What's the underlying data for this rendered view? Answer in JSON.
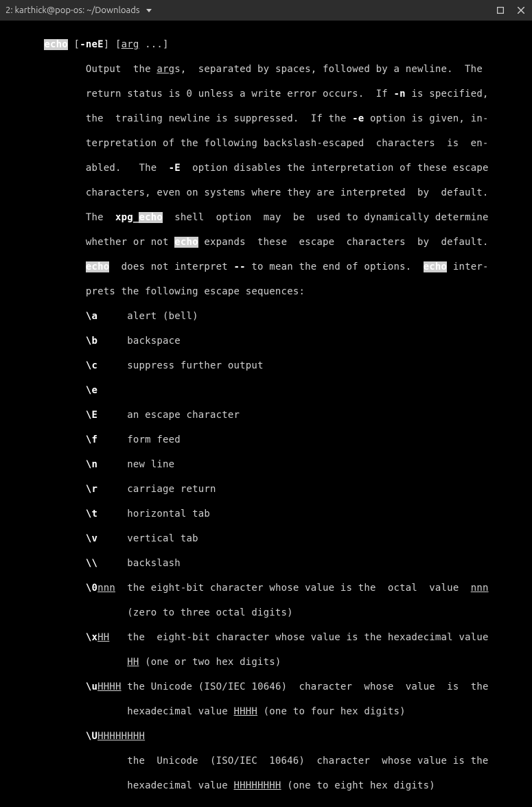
{
  "titlebar": {
    "title": "2: karthick@pop-os: ~/Downloads"
  },
  "cmd": {
    "echo": "echo",
    "neE": "-neE",
    "arg": "arg",
    "dots": " ...]"
  },
  "desc": {
    "l1a": "Output  the ",
    "l1b": "s,  separated by spaces, followed by a newline.  The",
    "l2a": "return status is 0 unless a write error occurs.  If ",
    "l2b": "-n",
    "l2c": " is specified,",
    "l3a": "the  trailing newline is suppressed.  If the ",
    "l3b": "-e",
    "l3c": " option is given, in-",
    "l4": "terpretation of the following backslash-escaped  characters  is  en-",
    "l5a": "abled.   The  ",
    "l5b": "-E",
    "l5c": "  option disables the interpretation of these escape",
    "l6": "characters, even on systems where they are interpreted  by  default.",
    "l7a": "The  ",
    "l7b": "xpg_",
    "l7c": "  shell  option  may  be  used to dynamically determine",
    "l8a": "whether or not ",
    "l8b": " expands  these  escape  characters  by  default.",
    "l9a": "  does not interpret ",
    "l9b": "--",
    "l9c": " to mean the end of options.  ",
    "l9d": " inter-",
    "l10": "prets the following escape sequences:"
  },
  "esc": {
    "a": {
      "k": "\\a",
      "v": "alert (bell)"
    },
    "b": {
      "k": "\\b",
      "v": "backspace"
    },
    "c": {
      "k": "\\c",
      "v": "suppress further output"
    },
    "e": {
      "k": "\\e",
      "v": ""
    },
    "E": {
      "k": "\\E",
      "v": "an escape character"
    },
    "f": {
      "k": "\\f",
      "v": "form feed"
    },
    "n": {
      "k": "\\n",
      "v": "new line"
    },
    "r": {
      "k": "\\r",
      "v": "carriage return"
    },
    "t": {
      "k": "\\t",
      "v": "horizontal tab"
    },
    "v": {
      "k": "\\v",
      "v": "vertical tab"
    },
    "bs": {
      "k": "\\\\",
      "v": "backslash"
    },
    "o0": {
      "k": "\\0",
      "p": "nnn",
      "v1": "the eight-bit character whose value is the  octal  value  ",
      "v2": "nnn",
      "v3": "(zero to three octal digits)"
    },
    "x": {
      "k": "\\x",
      "p": "HH",
      "v1": "the  eight-bit character whose value is the hexadecimal value",
      "v2": "HH",
      "v3": " (one or two hex digits)"
    },
    "u": {
      "k": "\\u",
      "p": "HHHH",
      "v1": "the Unicode (ISO/IEC 10646)  character  whose  value  is  the",
      "v2": "hexadecimal value ",
      "v3": "HHHH",
      "v4": " (one to four hex digits)"
    },
    "U": {
      "k": "\\U",
      "p": "HHHHHHHH",
      "v1": "the  Unicode  (ISO/IEC  10646)  character  whose value is the",
      "v2": "hexadecimal value ",
      "v3": "HHHHHHHH",
      "v4": " (one to eight hex digits)"
    }
  }
}
